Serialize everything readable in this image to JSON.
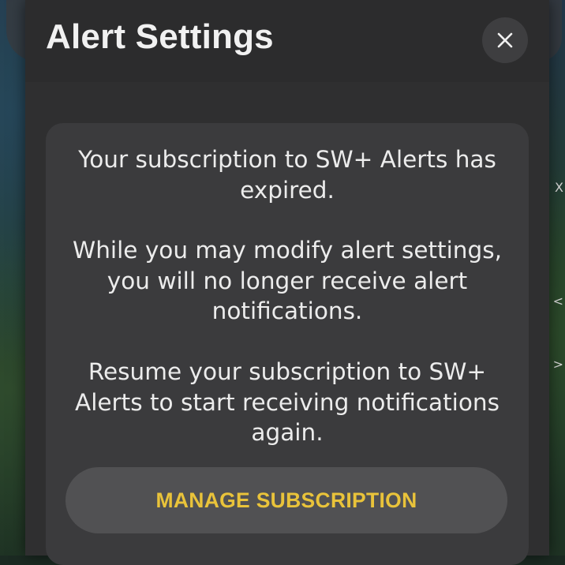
{
  "dialog": {
    "title": "Alert Settings",
    "close_icon": "close-icon",
    "message_paragraphs": [
      "Your subscription to SW+ Alerts has expired.",
      "While you may modify alert settings, you will no longer receive alert notifications.",
      "Resume your subscription to SW+ Alerts to start receiving notifications again."
    ],
    "manage_button_label": "MANAGE SUBSCRIPTION"
  },
  "background": {
    "right_edge_marks": [
      "X",
      "<",
      ">"
    ]
  },
  "colors": {
    "dialog_bg": "#2f2f30",
    "card_bg": "#3b3b3d",
    "button_bg": "#515153",
    "accent": "#e9c33a",
    "text": "#ececec"
  }
}
